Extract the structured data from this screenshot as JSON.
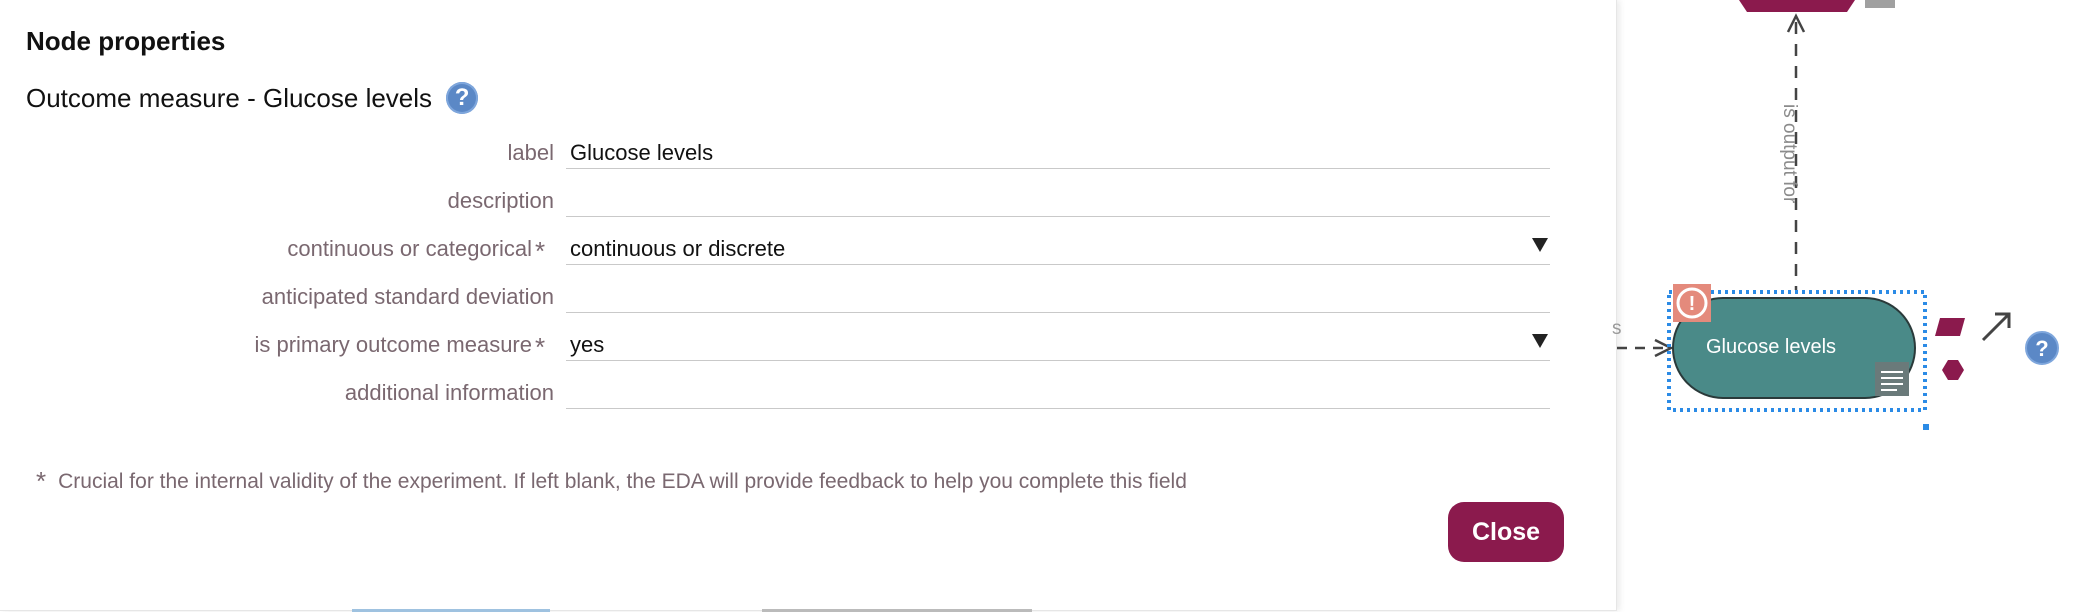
{
  "panel": {
    "title": "Node properties",
    "subtitle": "Outcome measure - Glucose levels",
    "help_icon": "?"
  },
  "fields": [
    {
      "label": "label",
      "value": "Glucose levels",
      "required": false,
      "type": "text"
    },
    {
      "label": "description",
      "value": "",
      "required": false,
      "type": "text"
    },
    {
      "label": "continuous or categorical",
      "value": "continuous or discrete",
      "required": true,
      "type": "select"
    },
    {
      "label": "anticipated standard deviation",
      "value": "",
      "required": false,
      "type": "text"
    },
    {
      "label": "is primary outcome measure",
      "value": "yes",
      "required": true,
      "type": "select"
    },
    {
      "label": "additional information",
      "value": "",
      "required": false,
      "type": "text"
    }
  ],
  "required_mark": "*",
  "footnote": "Crucial for the internal validity of the experiment. If left blank, the EDA will provide feedback to help you complete this field",
  "close_label": "Close",
  "diagram": {
    "node_label": "Glucose levels",
    "edge_label": "is output for",
    "edge_label_partial": "s",
    "warning_icon": "!",
    "help_icon": "?"
  },
  "colors": {
    "accent": "#8b1a4d",
    "node_fill": "#4a8a88",
    "selection": "#2b8be6",
    "help": "#5b88c6"
  }
}
